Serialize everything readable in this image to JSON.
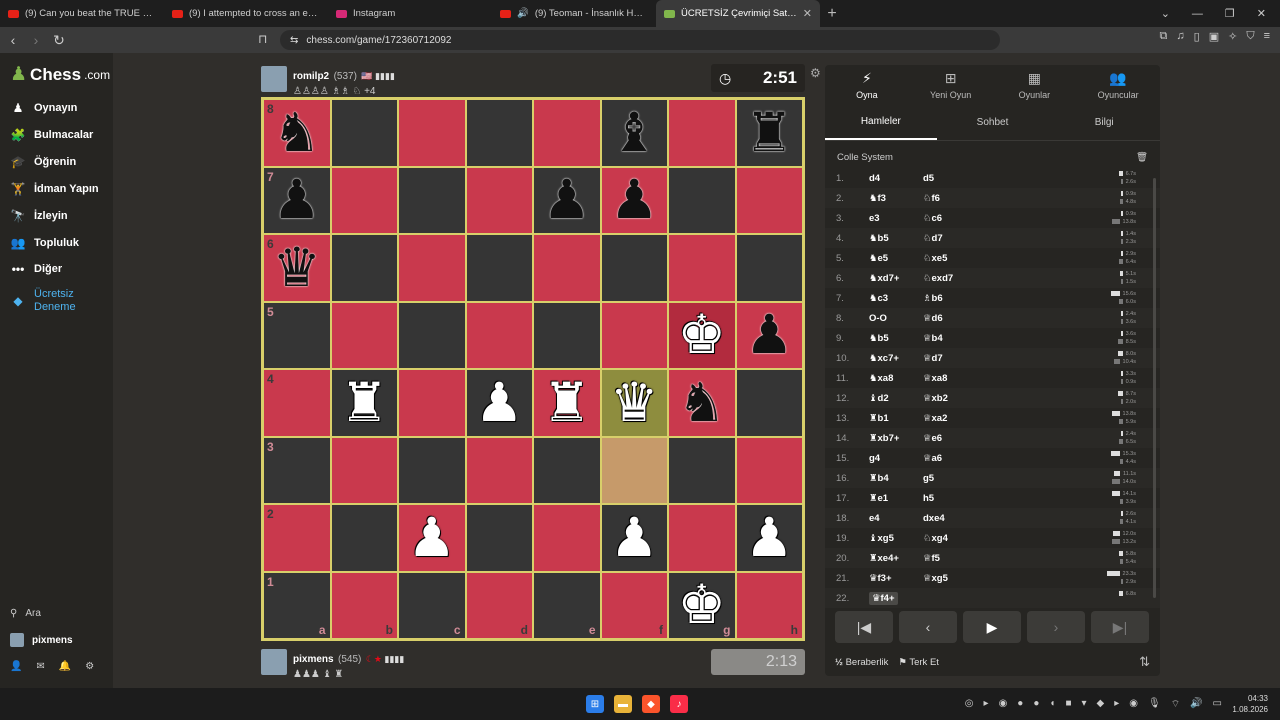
{
  "browser": {
    "tabs": [
      {
        "title": "(9) Can you beat the TRUE Skyblock?",
        "color": "#e62117"
      },
      {
        "title": "(9) I attempted to cross an entire cou",
        "color": "#e62117"
      },
      {
        "title": "Instagram",
        "color": "#d62976"
      },
      {
        "title": "(9) Teoman - İnsanlık Halleri (Full",
        "color": "#e62117",
        "audio": "🔊"
      },
      {
        "title": "ÜCRETSİZ Çevrimiçi Satranç Oyna",
        "color": "#81b64c",
        "active": true
      }
    ],
    "url": "chess.com/game/172360712092"
  },
  "sidebar": {
    "logo": "Chess",
    "logo_suffix": ".com",
    "items": [
      {
        "label": "Oynayın",
        "icon": "play-icon",
        "glyph": "♟"
      },
      {
        "label": "Bulmacalar",
        "icon": "puzzle-icon",
        "glyph": "🧩"
      },
      {
        "label": "Öğrenin",
        "icon": "learn-icon",
        "glyph": "🎓"
      },
      {
        "label": "İdman Yapın",
        "icon": "train-icon",
        "glyph": "🏋"
      },
      {
        "label": "İzleyin",
        "icon": "watch-icon",
        "glyph": "🔭"
      },
      {
        "label": "Topluluk",
        "icon": "community-icon",
        "glyph": "👥"
      },
      {
        "label": "Diğer",
        "icon": "more-icon",
        "glyph": "•••"
      }
    ],
    "trial_label": "Ücretsiz\nDeneme",
    "search_label": "Ara",
    "username": "pixmens"
  },
  "top_player": {
    "name": "romilp2",
    "rating": "(537)",
    "captured": "♙♙♙♙ ♗♗ ♘ +4"
  },
  "bottom_player": {
    "name": "pixmens",
    "rating": "(545)",
    "captured": "♟♟♟ ♝ ♜"
  },
  "clocks": {
    "top": "2:51",
    "bottom": "2:13"
  },
  "board": {
    "ranks": [
      "8",
      "7",
      "6",
      "5",
      "4",
      "3",
      "2",
      "1"
    ],
    "files": [
      "a",
      "b",
      "c",
      "d",
      "e",
      "f",
      "g",
      "h"
    ],
    "position": [
      [
        "bN",
        "",
        "",
        "",
        "",
        "bB",
        "",
        "bR"
      ],
      [
        "bP",
        "",
        "",
        "",
        "bP",
        "bP",
        "",
        ""
      ],
      [
        "bQ",
        "",
        "",
        "",
        "",
        "",
        "",
        ""
      ],
      [
        "",
        "",
        "",
        "",
        "",
        "",
        "wK",
        "bP"
      ],
      [
        "",
        "wR",
        "",
        "wP",
        "wR",
        "wQ",
        "bN",
        ""
      ],
      [
        "",
        "",
        "",
        "",
        "",
        "",
        "",
        ""
      ],
      [
        "",
        "",
        "wP",
        "",
        "",
        "wP",
        "",
        "wP"
      ],
      [
        "",
        "",
        "",
        "",
        "",
        "",
        "wK",
        ""
      ]
    ],
    "highlight": [
      "f4",
      "f3"
    ],
    "check": "g5"
  },
  "panel": {
    "top_tabs": [
      {
        "label": "Oyna",
        "icon": "bolt-icon",
        "glyph": "⚡",
        "active": true
      },
      {
        "label": "Yeni Oyun",
        "icon": "plus-square-icon",
        "glyph": "⊞"
      },
      {
        "label": "Oyunlar",
        "icon": "board-icon",
        "glyph": "▦"
      },
      {
        "label": "Oyuncular",
        "icon": "players-icon",
        "glyph": "👥"
      }
    ],
    "sub_tabs": [
      {
        "label": "Hamleler",
        "active": true
      },
      {
        "label": "Sohbet"
      },
      {
        "label": "Bilgi"
      }
    ],
    "opening": "Colle System",
    "moves": [
      {
        "n": "1.",
        "w": "d4",
        "b": "d5",
        "tw": "6.7s",
        "tb": "2.6s"
      },
      {
        "n": "2.",
        "w": "♞f3",
        "b": "♘f6",
        "tw": "0.9s",
        "tb": "4.8s"
      },
      {
        "n": "3.",
        "w": "e3",
        "b": "♘c6",
        "tw": "0.9s",
        "tb": "13.8s"
      },
      {
        "n": "4.",
        "w": "♞b5",
        "b": "♘d7",
        "tw": "1.4s",
        "tb": "2.3s"
      },
      {
        "n": "5.",
        "w": "♞e5",
        "b": "♘xe5",
        "tw": "2.9s",
        "tb": "6.4s"
      },
      {
        "n": "6.",
        "w": "♞xd7+",
        "b": "♘exd7",
        "tw": "5.1s",
        "tb": "1.5s"
      },
      {
        "n": "7.",
        "w": "♞c3",
        "b": "♗b6",
        "tw": "15.6s",
        "tb": "6.0s"
      },
      {
        "n": "8.",
        "w": "O-O",
        "b": "♕d6",
        "tw": "2.4s",
        "tb": "3.6s"
      },
      {
        "n": "9.",
        "w": "♞b5",
        "b": "♕b4",
        "tw": "3.6s",
        "tb": "8.5s"
      },
      {
        "n": "10.",
        "w": "♞xc7+",
        "b": "♕d7",
        "tw": "8.0s",
        "tb": "10.4s"
      },
      {
        "n": "11.",
        "w": "♞xa8",
        "b": "♕xa8",
        "tw": "3.3s",
        "tb": "0.9s"
      },
      {
        "n": "12.",
        "w": "♝d2",
        "b": "♕xb2",
        "tw": "8.7s",
        "tb": "2.0s"
      },
      {
        "n": "13.",
        "w": "♜b1",
        "b": "♕xa2",
        "tw": "13.8s",
        "tb": "5.9s"
      },
      {
        "n": "14.",
        "w": "♜xb7+",
        "b": "♕e6",
        "tw": "2.4s",
        "tb": "6.5s"
      },
      {
        "n": "15.",
        "w": "g4",
        "b": "♕a6",
        "tw": "15.3s",
        "tb": "4.4s"
      },
      {
        "n": "16.",
        "w": "♜b4",
        "b": "g5",
        "tw": "11.1s",
        "tb": "14.0s"
      },
      {
        "n": "17.",
        "w": "♜e1",
        "b": "h5",
        "tw": "14.1s",
        "tb": "3.9s"
      },
      {
        "n": "18.",
        "w": "e4",
        "b": "dxe4",
        "tw": "2.6s",
        "tb": "4.1s"
      },
      {
        "n": "19.",
        "w": "♝xg5",
        "b": "♘xg4",
        "tw": "12.0s",
        "tb": "13.2s"
      },
      {
        "n": "20.",
        "w": "♜xe4+",
        "b": "♕f5",
        "tw": "5.8s",
        "tb": "5.4s"
      },
      {
        "n": "21.",
        "w": "♛f3+",
        "b": "♕xg5",
        "tw": "23.3s",
        "tb": "2.9s"
      },
      {
        "n": "22.",
        "w": "♛f4+",
        "b": "",
        "tw": "6.8s",
        "tb": "",
        "current": true
      }
    ],
    "draw_label": "Beraberlik",
    "resign_label": "Terk Et"
  },
  "taskbar": {
    "time": "04:33",
    "date": "1.08.2026"
  }
}
